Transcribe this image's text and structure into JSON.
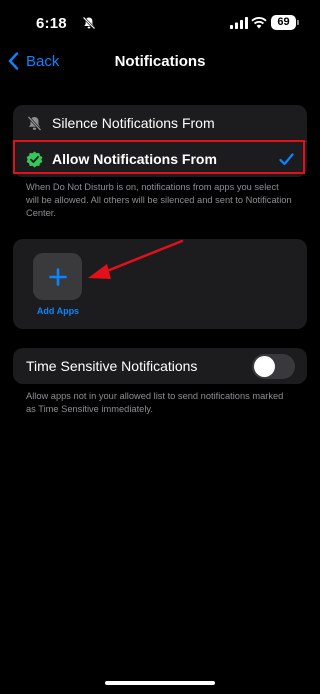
{
  "status": {
    "time": "6:18",
    "battery": "69"
  },
  "nav": {
    "back_label": "Back",
    "title": "Notifications"
  },
  "mode_options": {
    "silence_label": "Silence Notifications From",
    "allow_label": "Allow Notifications From",
    "selected": "allow"
  },
  "allow_footer": "When Do Not Disturb is on, notifications from apps you select will be allowed. All others will be silenced and sent to Notification Center.",
  "apps": {
    "add_label": "Add Apps"
  },
  "time_sensitive": {
    "label": "Time Sensitive Notifications",
    "enabled": false,
    "footer": "Allow apps not in your allowed list to send notifications marked as Time Sensitive immediately."
  },
  "colors": {
    "accent": "#0a84ff",
    "highlight": "#e2101a",
    "check_badge": "#34c759"
  }
}
